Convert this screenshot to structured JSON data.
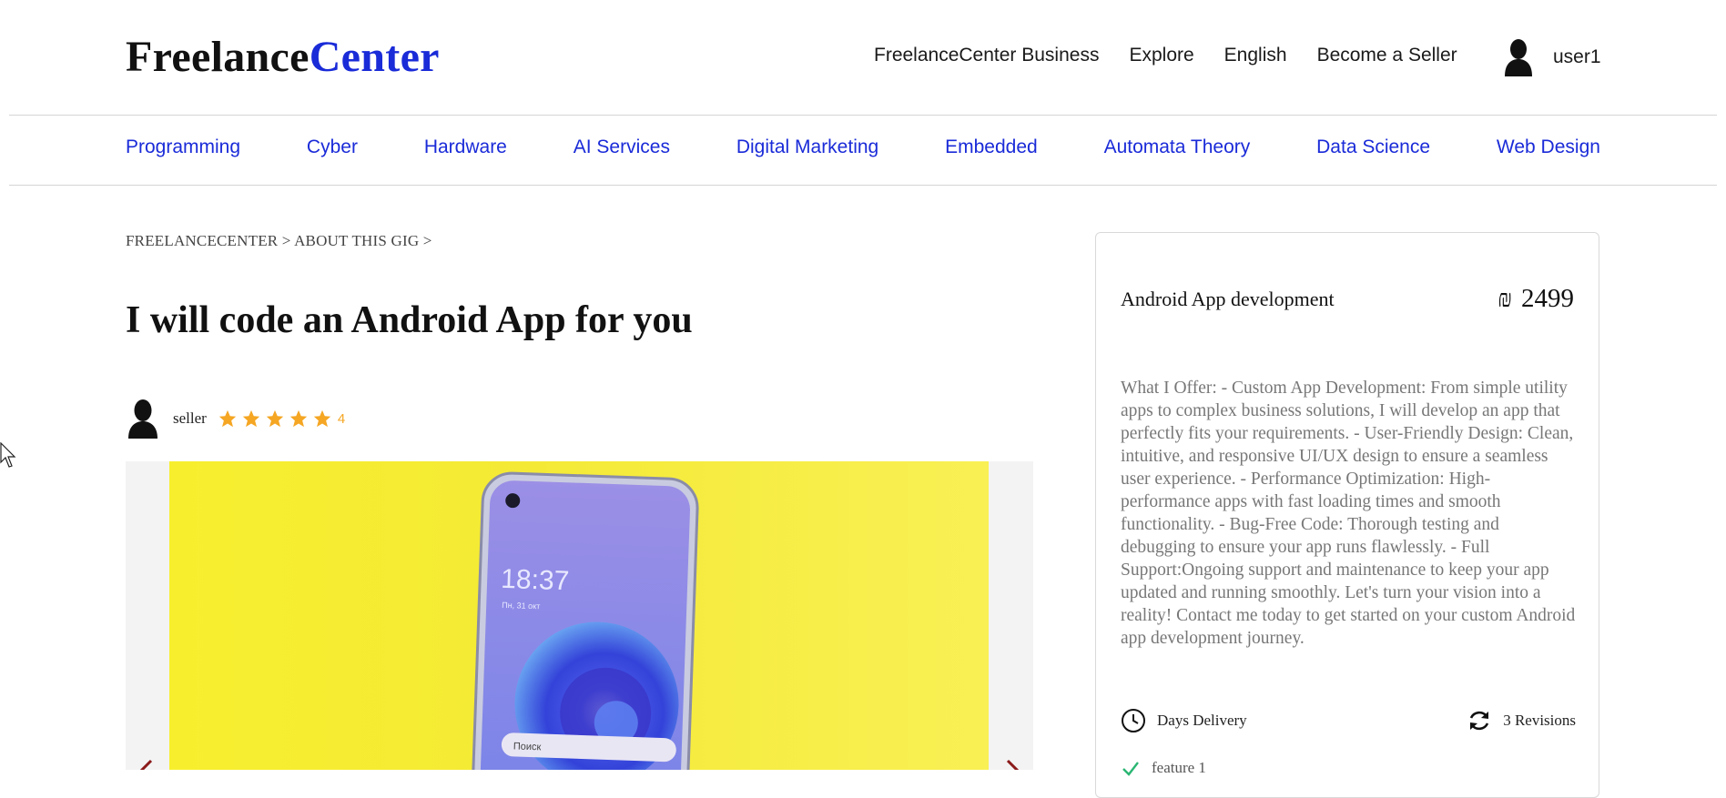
{
  "header": {
    "logo_part1": "Freelance",
    "logo_part2": "Center",
    "nav": [
      "FreelanceCenter Business",
      "Explore",
      "English",
      "Become a Seller"
    ],
    "username": "user1"
  },
  "categories": [
    "Programming",
    "Cyber",
    "Hardware",
    "AI Services",
    "Digital Marketing",
    "Embedded",
    "Automata Theory",
    "Data Science",
    "Web Design"
  ],
  "breadcrumb": "FREELANCECENTER > ABOUT THIS GIG >",
  "gig": {
    "title": "I will code an Android App for you",
    "seller_name": "seller",
    "rating": "4",
    "rating_value": 4,
    "stars_shown": 5
  },
  "package": {
    "name": "Android App development",
    "currency_symbol": "₪",
    "price": "2499",
    "description": "What I Offer: - Custom App Development: From simple utility apps to complex business solutions, I will develop an app that perfectly fits your requirements. - User-Friendly Design: Clean, intuitive, and responsive UI/UX design to ensure a seamless user experience. - Performance Optimization: High-performance apps with fast loading times and smooth functionality. - Bug-Free Code: Thorough testing and debugging to ensure your app runs flawlessly. - Full Support:Ongoing support and maintenance to keep your app updated and running smoothly. Let's turn your vision into a reality! Contact me today to get started on your custom Android app development journey.",
    "delivery": "Days Delivery",
    "revisions": "3 Revisions",
    "feature": "feature 1"
  },
  "phone_screen": {
    "clock": "18:37",
    "date": "Пн, 31 окт",
    "search_placeholder": "Поиск"
  },
  "colors": {
    "accent": "#1a2bd8",
    "star": "#f5a623",
    "slide_bg": "#f5ea2b",
    "arrow": "#8b1a1a"
  },
  "icons": {
    "user": "user-silhouette-icon",
    "star": "star-icon",
    "delivery": "clock-icon",
    "revisions": "refresh-icon",
    "feature": "check-icon",
    "carousel_prev": "chevron-left-icon",
    "carousel_next": "chevron-right-icon"
  }
}
